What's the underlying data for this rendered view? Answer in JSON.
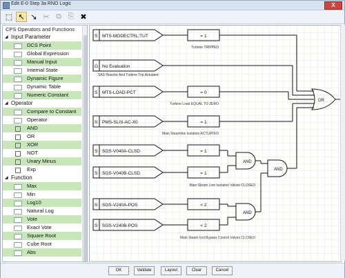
{
  "window": {
    "title": "Edit E-0 Step 3a RNO Logic",
    "close_glyph": "X"
  },
  "toolbar": {
    "buttons": [
      "⬚",
      "↖",
      "↘",
      "✂",
      "⧉",
      "⎘",
      "✖"
    ]
  },
  "panel": {
    "title": "CPS Operators and Functions",
    "categories": [
      {
        "label": "Input Parameter",
        "items": [
          "DCS Point",
          "Global Expression",
          "Manual Input",
          "Internal State",
          "Dynamic Figure",
          "Dynamic Table",
          "Numeric Constant"
        ]
      },
      {
        "label": "Operator",
        "items": [
          "Compare to Constant",
          "Operator",
          "AND",
          "OR",
          "XOR",
          "NOT",
          "Unary Minus",
          "Exp"
        ]
      },
      {
        "label": "Function",
        "items": [
          "Max",
          "Min",
          "Log10",
          "Natural Log",
          "Vote",
          "Exact Vote",
          "Square Root",
          "Cube Root",
          "Abs"
        ]
      }
    ]
  },
  "diagram": {
    "inputs": [
      {
        "type": "S",
        "label": "MTS-MODECTRL:TUT"
      },
      {
        "type": "G",
        "label": "No Evaluation"
      },
      {
        "type": "S",
        "label": "MTS-LOAD-PCT"
      },
      {
        "type": "S",
        "label": "PMS-SLIS-AC-X0"
      },
      {
        "type": "S",
        "label": "SGS-V040A-CLSD"
      },
      {
        "type": "S",
        "label": "SGS-V040B-CLSD"
      },
      {
        "type": "S",
        "label": "SGS-V240A-POS"
      },
      {
        "type": "S",
        "label": "SGS-V240B-POS"
      }
    ],
    "compares": [
      "= 1",
      "= 0",
      "= 1",
      "= 1",
      "= 1",
      "< 2",
      "< 2"
    ],
    "captions": [
      "Turbine TRIPPED",
      "SAS Reactor And Turbine Trip Actuated",
      "Turbine Load EQUAL TO ZERO",
      "Main Steamline Isolation ACTUATED",
      "Main Steam Line Isolation Valves CLOSED",
      "Main Steam Isol Bypass Control Valves CLOSED"
    ],
    "gates": [
      "AND",
      "AND",
      "AND",
      "OR"
    ]
  },
  "buttons": {
    "ok": "OK",
    "validate": "Validate",
    "layout": "Layout",
    "clear": "Clear",
    "cancel": "Cancel"
  },
  "colors": {
    "highlight": "#c7e7ba",
    "grid": "#eef3e7",
    "titlebar": "#d7e3f1",
    "close": "#c9473d"
  }
}
